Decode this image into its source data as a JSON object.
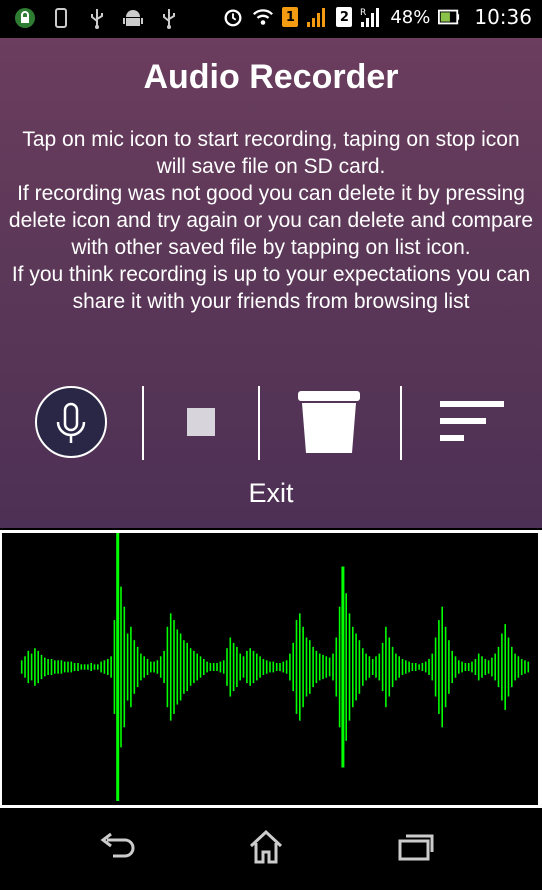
{
  "status_bar": {
    "left_icons": [
      "lock-icon",
      "phone-icon",
      "usb-icon",
      "android-icon",
      "usb-icon"
    ],
    "right_icons": [
      "alarm-icon",
      "wifi-icon",
      "sim1-icon",
      "signal-icon",
      "sim2-icon",
      "signal-roaming-icon"
    ],
    "sim1_label": "1",
    "sim2_label": "2",
    "battery": "48%",
    "time": "10:36"
  },
  "app": {
    "title": "Audio Recorder",
    "instructions": [
      "Tap on mic icon to start recording, taping on stop icon will save file on SD card.",
      "If recording was not good you can delete it by pressing delete icon and try again or you can delete and compare with other saved file by tapping on list icon.",
      "If you think recording is up to your expectations you can share it with your friends from browsing list"
    ],
    "controls": [
      "mic-icon",
      "stop-icon",
      "delete-icon",
      "list-icon"
    ],
    "exit_label": "Exit"
  },
  "waveform": {
    "color": "#00ff00",
    "background": "#000000",
    "amplitudes": [
      0.05,
      0.08,
      0.12,
      0.1,
      0.14,
      0.12,
      0.09,
      0.07,
      0.06,
      0.06,
      0.05,
      0.05,
      0.05,
      0.04,
      0.04,
      0.04,
      0.03,
      0.03,
      0.02,
      0.02,
      0.02,
      0.03,
      0.02,
      0.02,
      0.04,
      0.05,
      0.06,
      0.08,
      0.35,
      1.0,
      0.6,
      0.45,
      0.25,
      0.3,
      0.2,
      0.15,
      0.1,
      0.08,
      0.06,
      0.04,
      0.04,
      0.05,
      0.08,
      0.12,
      0.3,
      0.4,
      0.35,
      0.28,
      0.25,
      0.2,
      0.18,
      0.14,
      0.12,
      0.1,
      0.08,
      0.06,
      0.04,
      0.03,
      0.03,
      0.03,
      0.04,
      0.05,
      0.14,
      0.22,
      0.18,
      0.15,
      0.1,
      0.08,
      0.12,
      0.14,
      0.12,
      0.1,
      0.08,
      0.06,
      0.05,
      0.04,
      0.04,
      0.03,
      0.03,
      0.04,
      0.05,
      0.1,
      0.18,
      0.35,
      0.4,
      0.3,
      0.22,
      0.2,
      0.15,
      0.12,
      0.1,
      0.09,
      0.08,
      0.07,
      0.1,
      0.22,
      0.45,
      0.75,
      0.55,
      0.4,
      0.3,
      0.25,
      0.2,
      0.14,
      0.1,
      0.08,
      0.06,
      0.08,
      0.1,
      0.18,
      0.3,
      0.22,
      0.15,
      0.1,
      0.08,
      0.06,
      0.05,
      0.04,
      0.03,
      0.03,
      0.02,
      0.03,
      0.04,
      0.06,
      0.1,
      0.22,
      0.35,
      0.45,
      0.3,
      0.2,
      0.12,
      0.08,
      0.05,
      0.04,
      0.03,
      0.03,
      0.04,
      0.06,
      0.1,
      0.08,
      0.06,
      0.05,
      0.07,
      0.1,
      0.15,
      0.25,
      0.32,
      0.22,
      0.15,
      0.1,
      0.08,
      0.06,
      0.05,
      0.04
    ]
  },
  "nav_bar": {
    "buttons": [
      "back-icon",
      "home-icon",
      "recent-apps-icon"
    ]
  }
}
